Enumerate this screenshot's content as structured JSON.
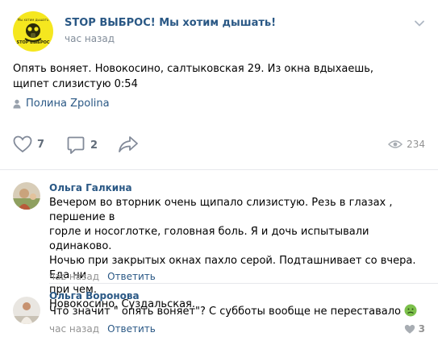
{
  "post": {
    "group_name": "STOP ВЫБРОС! Мы хотим дышать!",
    "time": "час назад",
    "avatar_caption": "Мы хотим дышать",
    "avatar_stop": "STOP ВЫБРОС",
    "text": "Опять воняет. Новокосино, салтыковская 29. Из окна вдыхаешь, щипет слизистую 0:54",
    "author": "Полина Zpolina",
    "likes": "7",
    "comments": "2",
    "views": "234"
  },
  "comments": [
    {
      "name": "Ольга Галкина",
      "lines": [
        "Вечером во вторник очень щипало слизистую. Резь в глазах , першение в",
        "горле и носоглотке, головная боль. Я и дочь испытывали одинаково.",
        "Ночью при закрытых окнах пахло серой. Подташнивает со вчера. Еда ни",
        "при чем.",
        "Новокосино. Суздальская."
      ],
      "time": "час назад",
      "reply": "Ответить"
    },
    {
      "name": "Ольга Воронова",
      "text": "Что значит \" опять воняет\"? С субботы вообще не переставало",
      "time": "час назад",
      "reply": "Ответить",
      "likes": "3"
    }
  ],
  "colors": {
    "link": "#2a5885",
    "muted": "#939393",
    "avatar_yellow": "#f5e71f"
  },
  "icons": [
    "more-icon",
    "user-icon",
    "like-icon",
    "comment-icon",
    "share-icon",
    "views-icon",
    "sick-emoji-icon"
  ]
}
